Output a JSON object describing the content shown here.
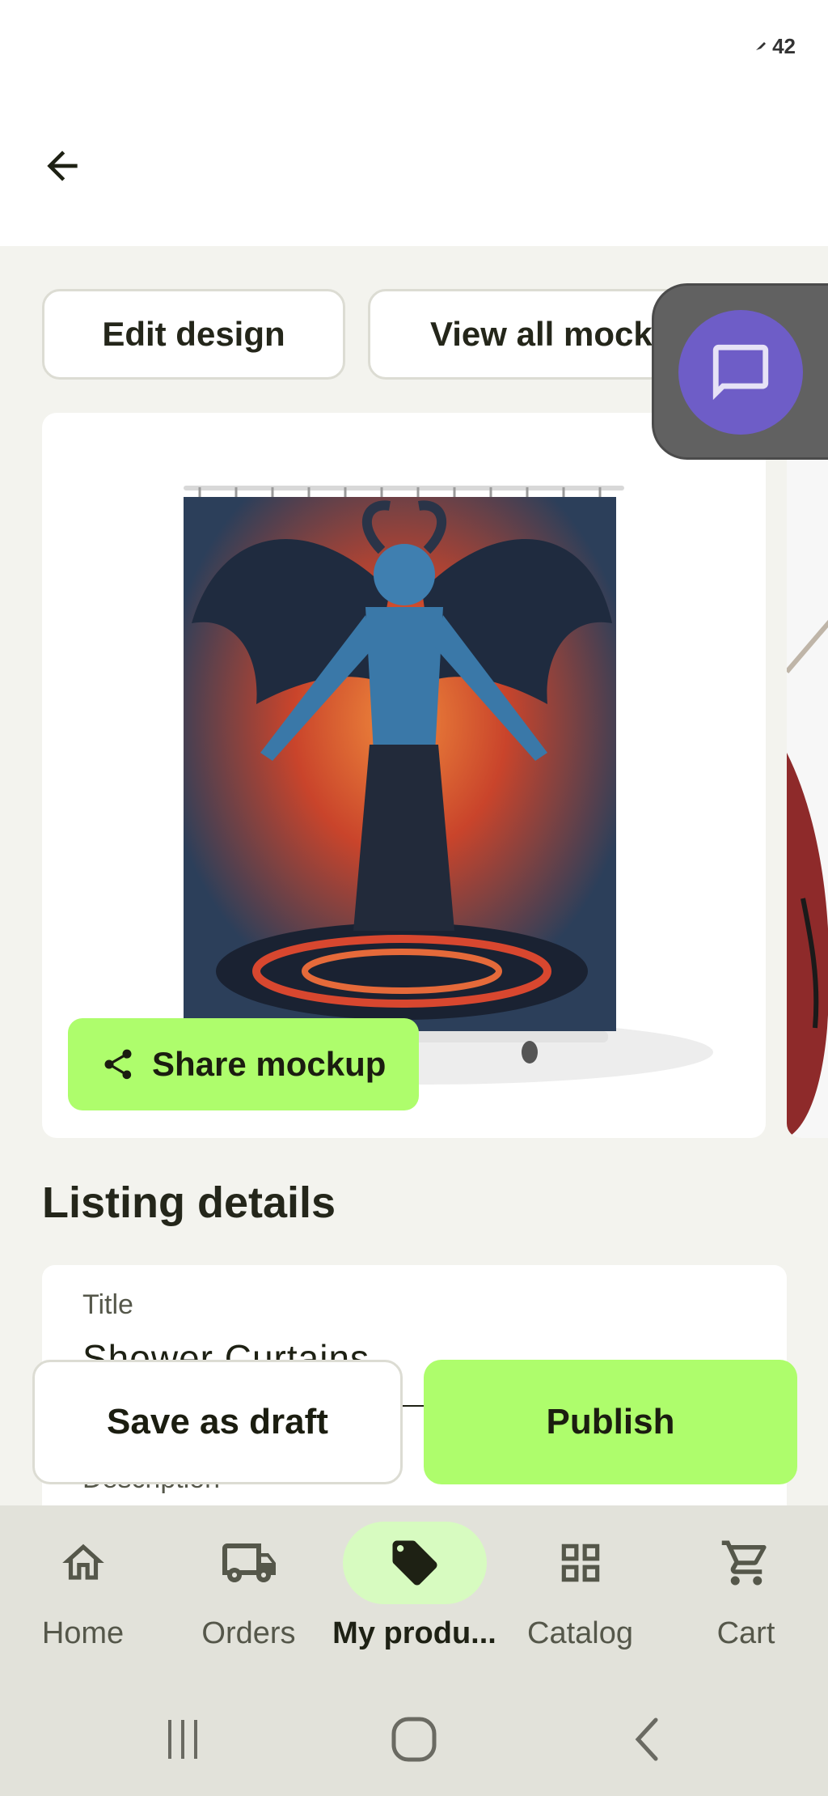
{
  "status": {
    "battery": "42"
  },
  "header": {
    "back_label": "Back"
  },
  "actions": {
    "edit_design": "Edit design",
    "view_all_mockups": "View all mock"
  },
  "mockup": {
    "share_label": "Share mockup"
  },
  "listing": {
    "section_title": "Listing details",
    "title_label": "Title",
    "title_value": "Shower Curtains",
    "description_label": "Description"
  },
  "footer": {
    "save_draft": "Save as draft",
    "publish": "Publish"
  },
  "nav": {
    "items": [
      {
        "label": "Home",
        "icon": "home-icon"
      },
      {
        "label": "Orders",
        "icon": "truck-icon"
      },
      {
        "label": "My produ...",
        "icon": "tag-icon",
        "active": true
      },
      {
        "label": "Catalog",
        "icon": "grid-icon"
      },
      {
        "label": "Cart",
        "icon": "cart-icon"
      }
    ]
  },
  "colors": {
    "accent": "#aefd6c",
    "chat": "#6e5dc7",
    "nav_active": "#d7fbc0"
  }
}
